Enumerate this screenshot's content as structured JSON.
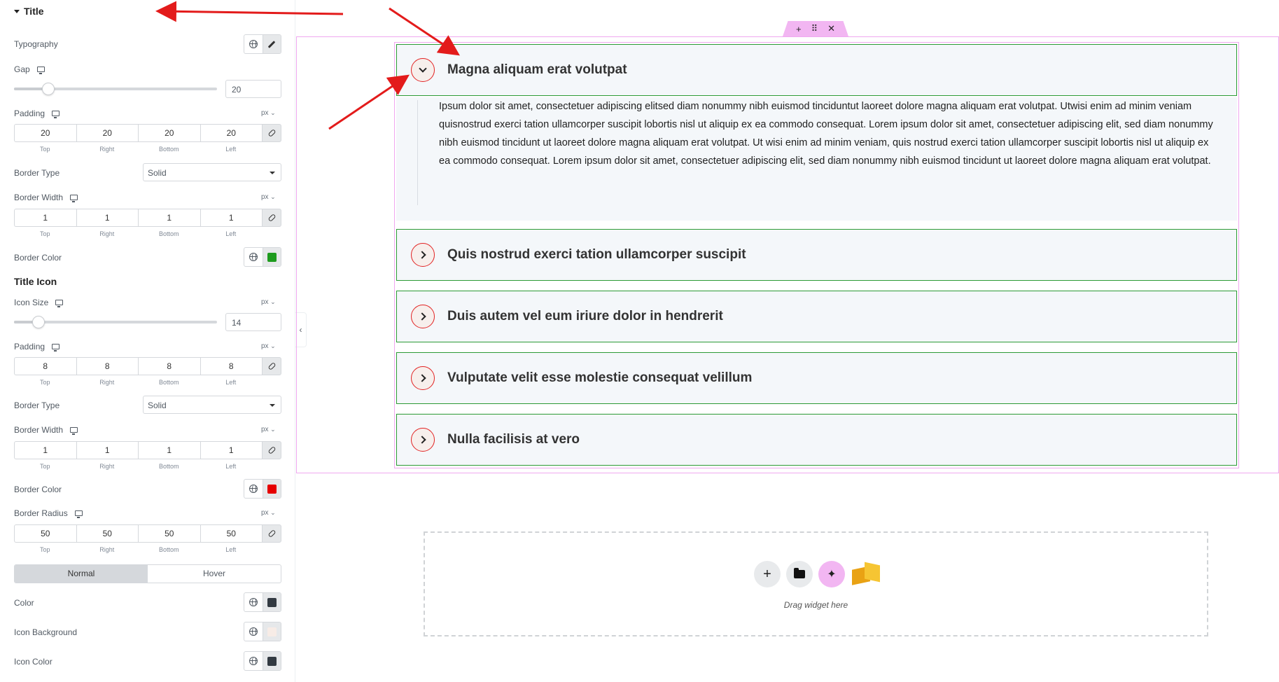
{
  "panel": {
    "section_title": "Title",
    "typography_label": "Typography",
    "gap": {
      "label": "Gap",
      "value": "20",
      "slider_percent": 17
    },
    "title_padding": {
      "label": "Padding",
      "unit": "px",
      "top": "20",
      "right": "20",
      "bottom": "20",
      "left": "20"
    },
    "title_border_type": {
      "label": "Border Type",
      "value": "Solid"
    },
    "title_border_width": {
      "label": "Border Width",
      "unit": "px",
      "top": "1",
      "right": "1",
      "bottom": "1",
      "left": "1"
    },
    "title_border_color": {
      "label": "Border Color",
      "color": "#1e9b1e"
    },
    "icon_section_title": "Title Icon",
    "icon_size": {
      "label": "Icon Size",
      "unit": "px",
      "value": "14",
      "slider_percent": 12
    },
    "icon_padding": {
      "label": "Padding",
      "unit": "px",
      "top": "8",
      "right": "8",
      "bottom": "8",
      "left": "8"
    },
    "icon_border_type": {
      "label": "Border Type",
      "value": "Solid"
    },
    "icon_border_width": {
      "label": "Border Width",
      "unit": "px",
      "top": "1",
      "right": "1",
      "bottom": "1",
      "left": "1"
    },
    "icon_border_color": {
      "label": "Border Color",
      "color": "#e60000"
    },
    "icon_border_radius": {
      "label": "Border Radius",
      "unit": "px",
      "top": "50",
      "right": "50",
      "bottom": "50",
      "left": "50"
    },
    "dim_labels": {
      "top": "Top",
      "right": "Right",
      "bottom": "Bottom",
      "left": "Left"
    },
    "tabs": {
      "normal": "Normal",
      "hover": "Hover"
    },
    "color": {
      "label": "Color",
      "color": "#333a42"
    },
    "icon_background": {
      "label": "Icon Background",
      "color": "#f7ece6"
    },
    "icon_color": {
      "label": "Icon Color",
      "color": "#333a42"
    }
  },
  "canvas": {
    "toolbar": {
      "add": "+",
      "move": "⠿",
      "close": "✕"
    },
    "accordion": [
      {
        "title": "Magna aliquam erat volutpat",
        "expanded": true
      },
      {
        "title": "Quis nostrud exerci tation ullamcorper suscipit",
        "expanded": false
      },
      {
        "title": "Duis autem vel eum iriure dolor in hendrerit",
        "expanded": false
      },
      {
        "title": "Vulputate velit esse molestie consequat velillum",
        "expanded": false
      },
      {
        "title": "Nulla facilisis at vero",
        "expanded": false
      }
    ],
    "expanded_body": "Ipsum dolor sit amet, consectetuer adipiscing elitsed diam nonummy nibh euismod tinciduntut laoreet dolore magna aliquam erat volutpat. Utwisi enim ad minim veniam quisnostrud exerci tation ullamcorper suscipit lobortis nisl ut aliquip ex ea commodo consequat. Lorem ipsum dolor sit amet, consectetuer adipiscing elit, sed diam nonummy nibh euismod tincidunt ut laoreet dolore magna aliquam erat volutpat. Ut wisi enim ad minim veniam, quis nostrud exerci tation ullamcorper suscipit lobortis nisl ut aliquip ex ea commodo consequat. Lorem ipsum dolor sit amet, consectetuer adipiscing elit, sed diam nonummy nibh euismod tincidunt ut laoreet dolore magna aliquam erat volutpat.",
    "drop_zone": {
      "text": "Drag widget here",
      "add": "+"
    }
  },
  "colors": {
    "annotation_arrow": "#e31b1b",
    "accordion_border": "#2c9a35",
    "section_outline": "#f0a8f0"
  }
}
